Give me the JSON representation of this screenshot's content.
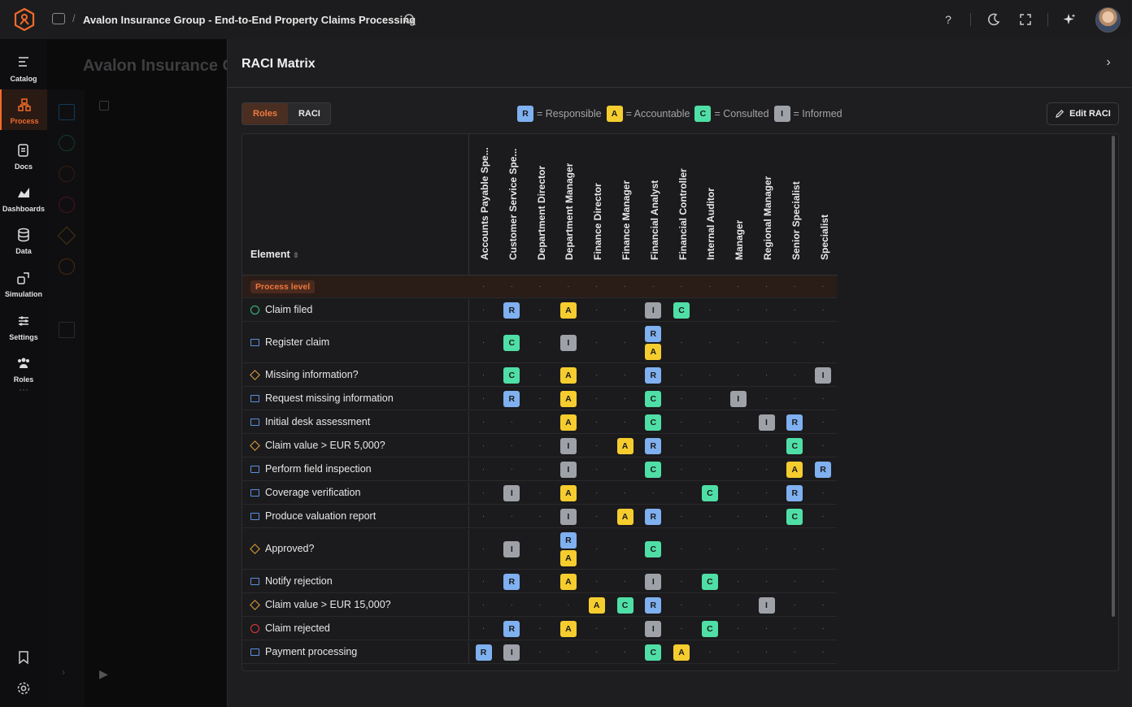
{
  "topbar": {
    "breadcrumb_sep": "/",
    "title": "Avalon Insurance Group - End-to-End Property Claims Processing",
    "icons": [
      "logo-icon",
      "folder-icon",
      "search-icon",
      "help-icon",
      "moon-icon",
      "expand-icon",
      "sparkle-icon"
    ],
    "help_glyph": "?"
  },
  "sidebar": {
    "items": [
      {
        "label": "Catalog",
        "icon": "catalog-icon"
      },
      {
        "label": "Process",
        "icon": "process-icon",
        "active": true
      },
      {
        "label": "Docs",
        "icon": "docs-icon"
      },
      {
        "label": "Dashboards",
        "icon": "dashboards-icon"
      },
      {
        "label": "Data",
        "icon": "data-icon"
      },
      {
        "label": "Simulation",
        "icon": "simulation-icon"
      },
      {
        "label": "Settings",
        "icon": "settings-icon"
      },
      {
        "label": "Roles",
        "icon": "roles-icon"
      }
    ],
    "more": "···"
  },
  "background": {
    "ghost_title": "Avalon Insurance G"
  },
  "panel": {
    "title": "RACI Matrix",
    "tabs": [
      "Roles",
      "RACI"
    ],
    "selected_tab": "Roles",
    "edit_label": "Edit RACI",
    "legend": [
      {
        "code": "R",
        "text": "= Responsible"
      },
      {
        "code": "A",
        "text": "= Accountable"
      },
      {
        "code": "C",
        "text": "= Consulted"
      },
      {
        "code": "I",
        "text": "= Informed"
      }
    ],
    "colors": {
      "R": "#7fb0f0",
      "A": "#f6cd2e",
      "C": "#4fdfa6",
      "I": "#9ea2a8",
      "accent": "#f26b2a"
    }
  },
  "matrix": {
    "element_header": "Element",
    "process_level_label": "Process level",
    "roles": [
      "Accounts Payable Spe...",
      "Customer Service Spe...",
      "Department Director",
      "Department Manager",
      "Finance Director",
      "Finance Manager",
      "Financial Analyst",
      "Financial Controller",
      "Internal Auditor",
      "Manager",
      "Regional Manager",
      "Senior Specialist",
      "Specialist"
    ],
    "rows": [
      {
        "name": "Claim filed",
        "shape": "circle-g",
        "cells": [
          "",
          "R",
          "",
          "A",
          "",
          "",
          "I",
          "C",
          "",
          "",
          "",
          "",
          ""
        ]
      },
      {
        "name": "Register claim",
        "shape": "rect",
        "cells": [
          "",
          "C",
          "",
          "I",
          "",
          "",
          "RA",
          "",
          "",
          "",
          "",
          "",
          ""
        ]
      },
      {
        "name": "Missing information?",
        "shape": "diamond",
        "cells": [
          "",
          "C",
          "",
          "A",
          "",
          "",
          "R",
          "",
          "",
          "",
          "",
          "",
          "I"
        ]
      },
      {
        "name": "Request missing information",
        "shape": "rect",
        "cells": [
          "",
          "R",
          "",
          "A",
          "",
          "",
          "C",
          "",
          "",
          "I",
          "",
          "",
          ""
        ]
      },
      {
        "name": "Initial desk assessment",
        "shape": "rect",
        "cells": [
          "",
          "",
          "",
          "A",
          "",
          "",
          "C",
          "",
          "",
          "",
          "I",
          "R",
          ""
        ]
      },
      {
        "name": "Claim value > EUR 5,000?",
        "shape": "diamond",
        "cells": [
          "",
          "",
          "",
          "I",
          "",
          "A",
          "R",
          "",
          "",
          "",
          "",
          "C",
          ""
        ]
      },
      {
        "name": "Perform field inspection",
        "shape": "rect",
        "cells": [
          "",
          "",
          "",
          "I",
          "",
          "",
          "C",
          "",
          "",
          "",
          "",
          "A",
          "R"
        ]
      },
      {
        "name": "Coverage verification",
        "shape": "rect",
        "cells": [
          "",
          "I",
          "",
          "A",
          "",
          "",
          "",
          "",
          "C",
          "",
          "",
          "R",
          ""
        ]
      },
      {
        "name": "Produce valuation report",
        "shape": "rect",
        "cells": [
          "",
          "",
          "",
          "I",
          "",
          "A",
          "R",
          "",
          "",
          "",
          "",
          "C",
          ""
        ]
      },
      {
        "name": "Approved?",
        "shape": "diamond",
        "cells": [
          "",
          "I",
          "",
          "RA",
          "",
          "",
          "C",
          "",
          "",
          "",
          "",
          "",
          ""
        ]
      },
      {
        "name": "Notify rejection",
        "shape": "rect",
        "cells": [
          "",
          "R",
          "",
          "A",
          "",
          "",
          "I",
          "",
          "C",
          "",
          "",
          "",
          ""
        ]
      },
      {
        "name": "Claim value > EUR 15,000?",
        "shape": "diamond",
        "cells": [
          "",
          "",
          "",
          "",
          "A",
          "C",
          "R",
          "",
          "",
          "",
          "I",
          "",
          ""
        ]
      },
      {
        "name": "Claim rejected",
        "shape": "circle-r",
        "cells": [
          "",
          "R",
          "",
          "A",
          "",
          "",
          "I",
          "",
          "C",
          "",
          "",
          "",
          ""
        ]
      },
      {
        "name": "Payment processing",
        "shape": "rect",
        "cells": [
          "R",
          "I",
          "",
          "",
          "",
          "",
          "C",
          "A",
          "",
          "",
          "",
          "",
          ""
        ]
      }
    ]
  }
}
